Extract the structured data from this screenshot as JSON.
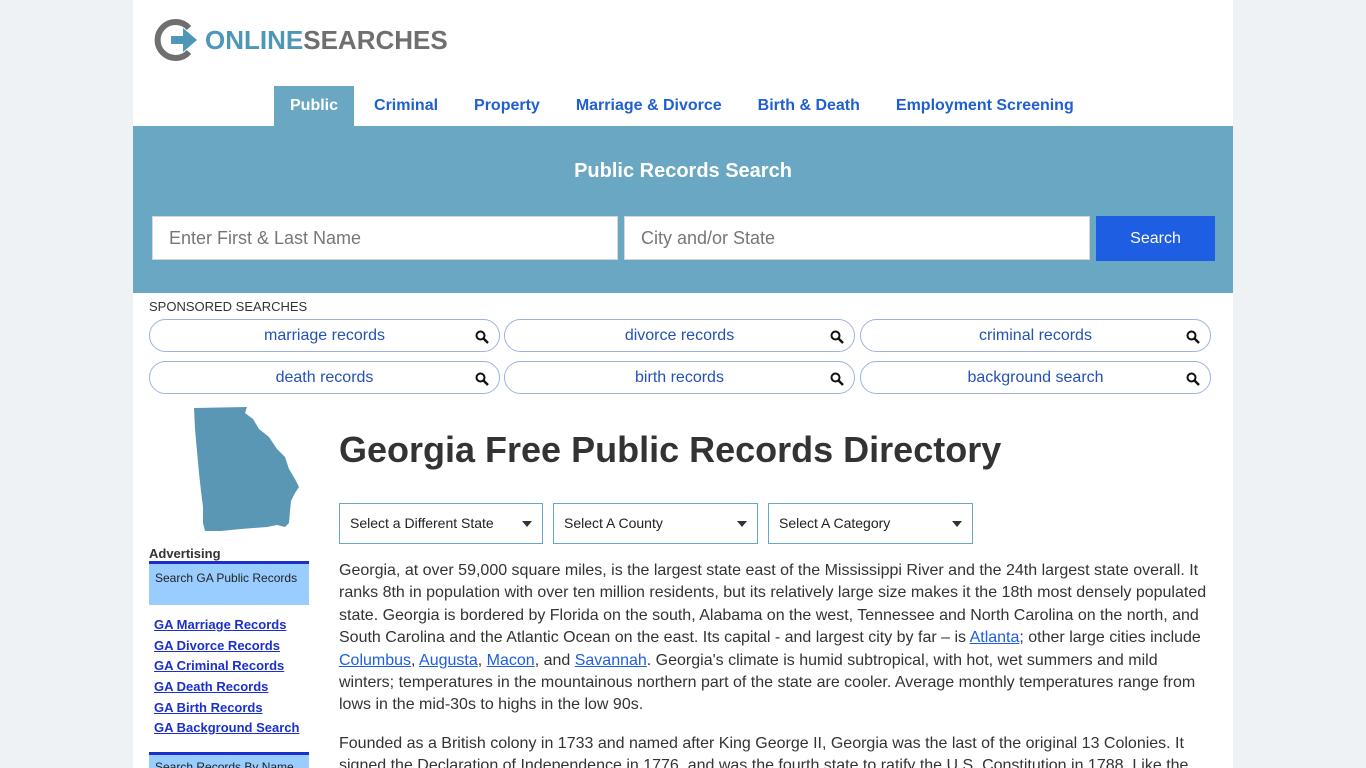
{
  "logo": {
    "part1": "ONLINE",
    "part2": "SEARCHES",
    "icon": "arrow-circle-logo-icon"
  },
  "nav": [
    {
      "label": "Public",
      "active": true
    },
    {
      "label": "Criminal"
    },
    {
      "label": "Property"
    },
    {
      "label": "Marriage & Divorce"
    },
    {
      "label": "Birth & Death"
    },
    {
      "label": "Employment Screening"
    }
  ],
  "hero": {
    "title": "Public Records Search",
    "name_placeholder": "Enter First & Last Name",
    "city_placeholder": "City and/or State",
    "search_label": "Search"
  },
  "sponsored": {
    "label": "SPONSORED SEARCHES",
    "items": [
      "marriage records",
      "divorce records",
      "criminal records",
      "death records",
      "birth records",
      "background search"
    ]
  },
  "sidebar": {
    "advertising_label": "Advertising",
    "box_title": "Search GA Public Records",
    "links": [
      "GA Marriage Records",
      "GA Divorce Records",
      "GA Criminal Records",
      "GA Death Records",
      "GA Birth Records",
      "GA Background Search"
    ],
    "box2_title": "Search Records By Name"
  },
  "main": {
    "title": "Georgia Free Public Records Directory",
    "select_state": "Select a Different State",
    "select_county": "Select A County",
    "select_category": "Select A Category",
    "p1_a": "Georgia, at over 59,000 square miles, is the largest state east of the Mississippi River and the 24th largest state overall. It ranks 8th in population with over ten million residents, but its relatively large size makes it the 18th most densely populated state. Georgia is bordered by Florida on the south, Alabama on the west, Tennessee and North Carolina on the north, and South Carolina and the Atlantic Ocean on the east. Its capital - and largest city by far – is ",
    "link_atlanta": "Atlanta",
    "p1_b": "; other large cities include ",
    "link_columbus": "Columbus",
    "sep1": ", ",
    "link_augusta": "Augusta",
    "sep2": ", ",
    "link_macon": "Macon",
    "sep3": ", and ",
    "link_savannah": "Savannah",
    "p1_c": ". Georgia's climate is humid subtropical, with hot, wet summers and mild winters; temperatures in the mountainous northern part of the state are cooler. Average monthly temperatures range from lows in the mid-30s to highs in the low 90s.",
    "p2": "Founded as a British colony in 1733 and named after King George II, Georgia was the last of the original 13 Colonies. It signed the Declaration of Independence in 1776, and was the fourth state to ratify the U.S. Constitution in 1788. Like the"
  },
  "colors": {
    "accent": "#6aa7c2",
    "button": "#1d5ee2",
    "nav_link": "#1f5fd0",
    "map": "#5a97b5"
  }
}
